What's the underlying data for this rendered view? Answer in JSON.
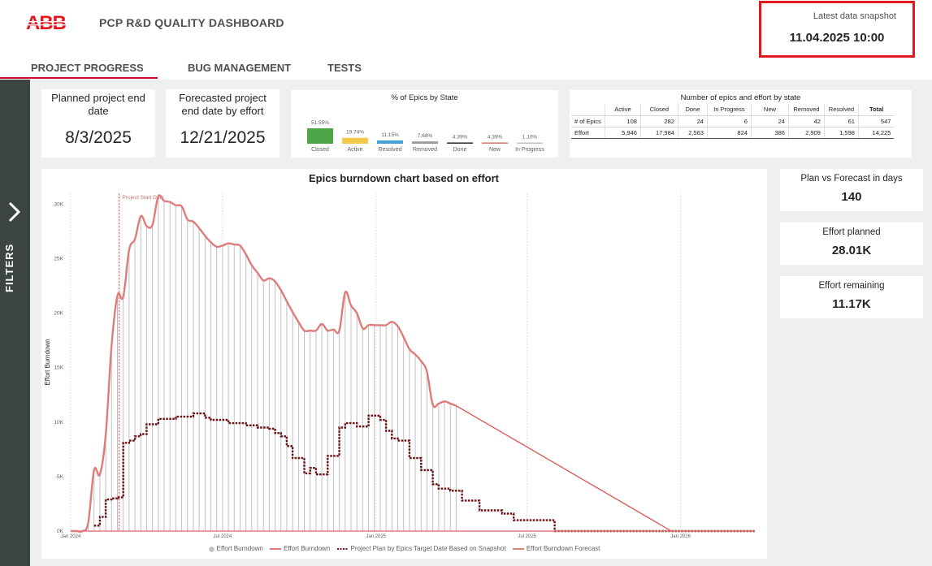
{
  "header": {
    "logo_text": "ABB",
    "title": "PCP R&D QUALITY DASHBOARD",
    "snapshot_label": "Latest data snapshot",
    "snapshot_value": "11.04.2025 10:00",
    "brand_color": "#e3181d"
  },
  "tabs": [
    {
      "label": "PROJECT PROGRESS",
      "active": true
    },
    {
      "label": "BUG MANAGEMENT",
      "active": false
    },
    {
      "label": "TESTS",
      "active": false
    }
  ],
  "filters": {
    "label": "FILTERS"
  },
  "cards": {
    "planned_end": {
      "title": "Planned project end date",
      "value": "8/3/2025"
    },
    "forecast_end": {
      "title": "Forecasted project end date by effort",
      "value": "12/21/2025"
    }
  },
  "kpis": {
    "plan_vs_forecast": {
      "title": "Plan vs Forecast in days",
      "value": "140"
    },
    "effort_planned": {
      "title": "Effort planned",
      "value": "28.01K"
    },
    "effort_remaining": {
      "title": "Effort remaining",
      "value": "11.17K"
    }
  },
  "epics_table": {
    "title": "Number of epics and effort by state",
    "columns": [
      "Active",
      "Closed",
      "Done",
      "In Progress",
      "New",
      "Removed",
      "Resolved",
      "Total"
    ],
    "rows": [
      {
        "label": "# of Epics",
        "values": [
          "108",
          "282",
          "24",
          "6",
          "24",
          "42",
          "61",
          "547"
        ]
      },
      {
        "label": "Effort",
        "values": [
          "5,946",
          "17,984",
          "2,563",
          "824",
          "386",
          "2,909",
          "1,598",
          "14,225"
        ]
      }
    ]
  },
  "chart_data": [
    {
      "type": "bar",
      "title": "% of Epics by State",
      "categories": [
        "Closed",
        "Active",
        "Resolved",
        "Removed",
        "Done",
        "New",
        "In Progress"
      ],
      "values": [
        51.55,
        19.74,
        11.15,
        7.68,
        4.39,
        4.39,
        1.1
      ],
      "labels": [
        "51.55%",
        "19.74%",
        "11.15%",
        "7.68%",
        "4.39%",
        "4.39%",
        "1.10%"
      ],
      "colors": [
        "#4ea547",
        "#f2c94c",
        "#45a3d8",
        "#9b9b9b",
        "#3a3a3a",
        "#e07b7b",
        "#c0c0c0"
      ],
      "ylim": [
        0,
        51.55
      ]
    },
    {
      "type": "line",
      "title": "Epics burndown chart based on effort",
      "ylabel": "Effort Burndown",
      "ylim": [
        0,
        31000
      ],
      "yticks": [
        0,
        5000,
        10000,
        15000,
        20000,
        25000,
        30000
      ],
      "ytick_labels": [
        "0K",
        "5K",
        "10K",
        "15K",
        "20K",
        "25K",
        "30K"
      ],
      "xlim": [
        "2024-01-01",
        "2026-03-31"
      ],
      "xticks": [
        "2024-01-01",
        "2024-07-01",
        "2025-01-01",
        "2025-07-01",
        "2026-01-01"
      ],
      "xtick_labels": [
        "Jan 2024",
        "Jul 2024",
        "Jan 2025",
        "Jul 2025",
        "Jan 2026"
      ],
      "annotation": {
        "label": "Project Start Date",
        "x": "2024-02-28"
      },
      "grid": false,
      "legend_position": "bottom",
      "series": [
        {
          "name": "Effort Burndown",
          "kind": "column",
          "color": "#c0c0c0",
          "x": [
            "2024-01-01",
            "2024-01-08",
            "2024-01-15",
            "2024-01-22",
            "2024-01-29",
            "2024-02-05",
            "2024-02-12",
            "2024-02-19",
            "2024-02-26",
            "2024-03-04",
            "2024-03-11",
            "2024-03-18",
            "2024-03-25",
            "2024-04-01",
            "2024-04-08",
            "2024-04-15",
            "2024-04-22",
            "2024-04-29",
            "2024-05-06",
            "2024-05-13",
            "2024-05-20",
            "2024-05-27",
            "2024-06-03",
            "2024-06-10",
            "2024-06-17",
            "2024-06-24",
            "2024-07-01",
            "2024-07-08",
            "2024-07-15",
            "2024-07-22",
            "2024-07-29",
            "2024-08-05",
            "2024-08-12",
            "2024-08-19",
            "2024-08-26",
            "2024-09-02",
            "2024-09-09",
            "2024-09-16",
            "2024-09-23",
            "2024-09-30",
            "2024-10-07",
            "2024-10-14",
            "2024-10-21",
            "2024-10-28",
            "2024-11-04",
            "2024-11-11",
            "2024-11-18",
            "2024-11-25",
            "2024-12-02",
            "2024-12-09",
            "2024-12-16",
            "2024-12-23",
            "2024-12-30",
            "2025-01-06",
            "2025-01-13",
            "2025-01-20",
            "2025-01-27",
            "2025-02-03",
            "2025-02-10",
            "2025-02-17",
            "2025-02-24",
            "2025-03-03",
            "2025-03-10",
            "2025-03-17",
            "2025-03-24",
            "2025-03-31",
            "2025-04-07"
          ],
          "values": [
            0,
            0,
            0,
            800,
            5600,
            5200,
            8800,
            17000,
            21600,
            21500,
            25800,
            26800,
            28900,
            28000,
            28100,
            30700,
            30300,
            30200,
            29900,
            29800,
            28600,
            28400,
            27800,
            27100,
            26500,
            26100,
            26200,
            26400,
            26300,
            26200,
            25400,
            24400,
            23700,
            23000,
            23200,
            22900,
            22100,
            21100,
            20100,
            19200,
            18400,
            18400,
            18400,
            19000,
            18400,
            18500,
            18400,
            21900,
            20700,
            20000,
            18600,
            18900,
            18900,
            18900,
            18900,
            19200,
            18800,
            17800,
            16700,
            16200,
            15600,
            14600,
            11600,
            11700,
            11900,
            11700,
            11500
          ]
        },
        {
          "name": "Effort Burndown",
          "kind": "line",
          "color": "#e07b7b",
          "x": [
            "2024-01-01",
            "2024-01-08",
            "2024-01-15",
            "2024-01-22",
            "2024-01-29",
            "2024-02-05",
            "2024-02-12",
            "2024-02-19",
            "2024-02-26",
            "2024-03-04",
            "2024-03-11",
            "2024-03-18",
            "2024-03-25",
            "2024-04-01",
            "2024-04-08",
            "2024-04-15",
            "2024-04-22",
            "2024-04-29",
            "2024-05-06",
            "2024-05-13",
            "2024-05-20",
            "2024-05-27",
            "2024-06-03",
            "2024-06-10",
            "2024-06-17",
            "2024-06-24",
            "2024-07-01",
            "2024-07-08",
            "2024-07-15",
            "2024-07-22",
            "2024-07-29",
            "2024-08-05",
            "2024-08-12",
            "2024-08-19",
            "2024-08-26",
            "2024-09-02",
            "2024-09-09",
            "2024-09-16",
            "2024-09-23",
            "2024-09-30",
            "2024-10-07",
            "2024-10-14",
            "2024-10-21",
            "2024-10-28",
            "2024-11-04",
            "2024-11-11",
            "2024-11-18",
            "2024-11-25",
            "2024-12-02",
            "2024-12-09",
            "2024-12-16",
            "2024-12-23",
            "2024-12-30",
            "2025-01-06",
            "2025-01-13",
            "2025-01-20",
            "2025-01-27",
            "2025-02-03",
            "2025-02-10",
            "2025-02-17",
            "2025-02-24",
            "2025-03-03",
            "2025-03-10",
            "2025-03-17",
            "2025-03-24",
            "2025-03-31",
            "2025-04-07"
          ],
          "values": [
            0,
            0,
            0,
            800,
            5600,
            5200,
            8800,
            17000,
            21600,
            21500,
            25800,
            26800,
            28900,
            28000,
            28100,
            30700,
            30300,
            30200,
            29900,
            29800,
            28600,
            28400,
            27800,
            27100,
            26500,
            26100,
            26200,
            26400,
            26300,
            26200,
            25400,
            24400,
            23700,
            23000,
            23200,
            22900,
            22100,
            21100,
            20100,
            19200,
            18400,
            18400,
            18400,
            19000,
            18400,
            18500,
            18400,
            21900,
            20700,
            20000,
            18600,
            18900,
            18900,
            18900,
            18900,
            19200,
            18800,
            17800,
            16700,
            16200,
            15600,
            14600,
            11600,
            11700,
            11900,
            11700,
            11500
          ]
        },
        {
          "name": "Project Plan by Epics Target Date Based on Snapshot",
          "kind": "step",
          "color": "#6b0f0f",
          "x": [
            "2024-01-29",
            "2024-02-05",
            "2024-02-12",
            "2024-02-19",
            "2024-02-26",
            "2024-03-04",
            "2024-03-11",
            "2024-03-18",
            "2024-03-25",
            "2024-04-01",
            "2024-04-15",
            "2024-05-06",
            "2024-05-27",
            "2024-06-03",
            "2024-06-10",
            "2024-06-17",
            "2024-07-08",
            "2024-07-29",
            "2024-08-12",
            "2024-08-26",
            "2024-09-02",
            "2024-09-09",
            "2024-09-16",
            "2024-09-23",
            "2024-10-07",
            "2024-10-14",
            "2024-10-21",
            "2024-11-04",
            "2024-11-18",
            "2024-11-25",
            "2024-12-09",
            "2024-12-23",
            "2025-01-06",
            "2025-01-13",
            "2025-01-20",
            "2025-01-27",
            "2025-02-10",
            "2025-02-24",
            "2025-03-10",
            "2025-03-17",
            "2025-03-31",
            "2025-04-14",
            "2025-05-05",
            "2025-06-01",
            "2025-06-15",
            "2025-08-03",
            "2026-03-31"
          ],
          "values": [
            500,
            1300,
            2900,
            3000,
            3100,
            8100,
            8300,
            8700,
            8900,
            9800,
            10300,
            10500,
            10800,
            10800,
            10400,
            10200,
            9900,
            9700,
            9500,
            9400,
            9000,
            8700,
            7800,
            6700,
            5300,
            5800,
            5200,
            6900,
            9500,
            9900,
            9600,
            10600,
            10200,
            9200,
            8500,
            8300,
            6700,
            5600,
            4300,
            3900,
            3700,
            2800,
            1900,
            1600,
            1000,
            0,
            0
          ]
        },
        {
          "name": "Effort Burndown Forecast",
          "kind": "line",
          "color": "#d9534f",
          "x": [
            "2025-04-07",
            "2025-12-21"
          ],
          "values": [
            11500,
            0
          ]
        }
      ]
    }
  ]
}
